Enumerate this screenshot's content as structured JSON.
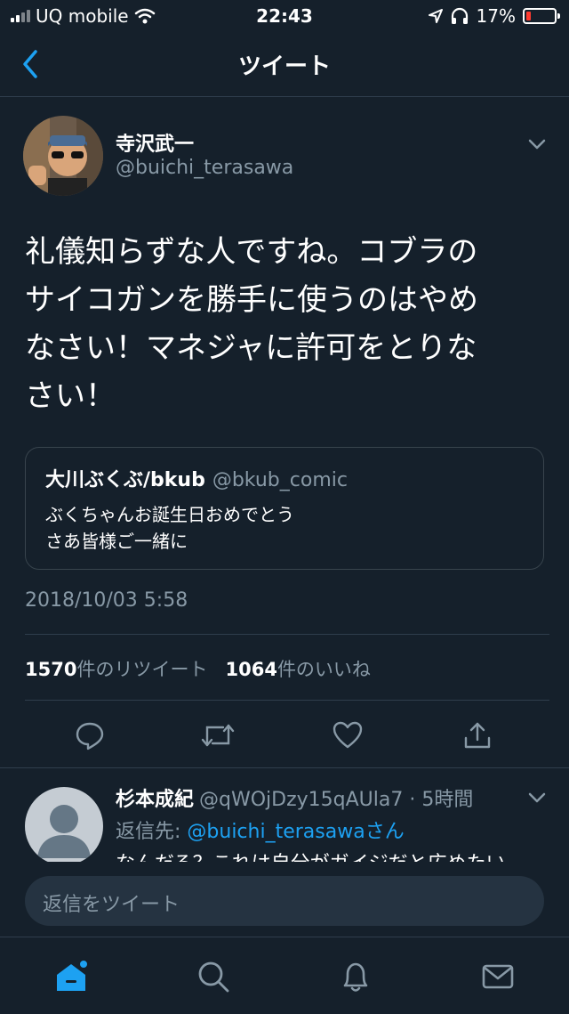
{
  "status_bar": {
    "carrier": "UQ mobile",
    "time": "22:43",
    "battery": "17%",
    "battery_level": 0.17
  },
  "nav": {
    "title": "ツイート"
  },
  "tweet": {
    "name": "寺沢武一",
    "handle": "@buichi_terasawa",
    "text_lines": [
      "礼儀知らずな人ですね。コブラの",
      "サイコガンを勝手に使うのはやめ",
      "なさい！マネジャに許可をとりな",
      "さい！"
    ],
    "quote": {
      "name": "大川ぶくぶ/bkub",
      "handle": "@bkub_comic",
      "line1": "ぶくちゃんお誕生日おめでとう",
      "line2": "さあ皆様ご一緒に"
    },
    "datetime": "2018/10/03 5:58",
    "retweet_count": "1570",
    "retweet_label": "件のリツイート",
    "like_count": "1064",
    "like_label": "件のいいね"
  },
  "actions": [
    "reply-icon",
    "retweet-icon",
    "heart-icon",
    "share-icon"
  ],
  "reply": {
    "name": "杉本成紀",
    "handle_time": "@qWOjDzy15qAUla7 · 5時間",
    "reply_to_label": "返信先: ",
    "reply_to_handle": "@buichi_terasawa",
    "reply_to_suffix": "さん",
    "text_partial": "なんだろ？これは自分がガイジだと広めたい"
  },
  "compose": {
    "placeholder": "返信をツイート"
  },
  "tabbar": [
    "home-icon",
    "search-icon",
    "notifications-icon",
    "messages-icon"
  ],
  "colors": {
    "background": "#15202b",
    "accent": "#1da1f2",
    "secondary_text": "#8899a6"
  }
}
